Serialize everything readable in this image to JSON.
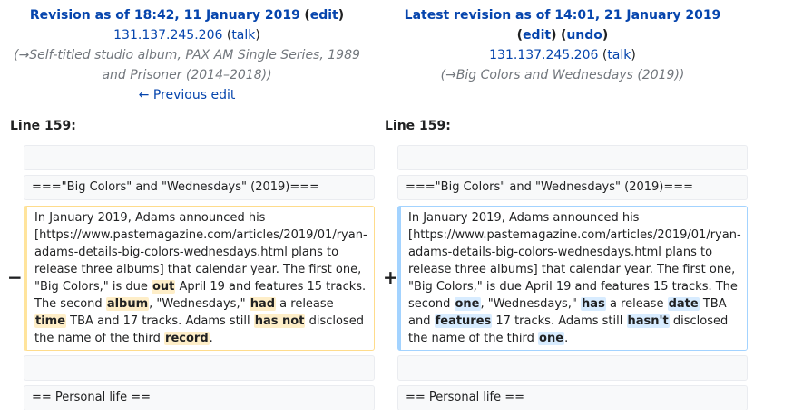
{
  "left_header": {
    "title": "Revision as of 18:42, 11 January 2019",
    "edit": "edit",
    "user": "131.137.245.206",
    "talk": "talk",
    "summary_arrow": "→",
    "summary": "Self-titled studio album, PAX AM Single Series, 1989 and Prisoner (2014–2018)",
    "prev_edit": "← Previous edit"
  },
  "right_header": {
    "title": "Latest revision as of 14:01, 21 January 2019",
    "edit": "edit",
    "undo": "undo",
    "user": "131.137.245.206",
    "talk": "talk",
    "summary_arrow": "→",
    "summary": "Big Colors and Wednesdays (2019)"
  },
  "left_line": "Line 159:",
  "right_line": "Line 159:",
  "context": {
    "heading": "===\"Big Colors\" and \"Wednesdays\" (2019)===",
    "personal": "== Personal life =="
  },
  "markers": {
    "minus": "−",
    "plus": "+"
  },
  "left_para": {
    "t1": "In January 2019, Adams announced his [https://www.pastemagazine.com/articles/2019/01/ryan-adams-details-big-colors-wednesdays.html plans to release three albums] that calendar year. The first one, \"Big Colors,\" is due ",
    "w1": "out",
    "t2": " April 19 and features 15 tracks. The second ",
    "w2": "album",
    "t3": ", \"Wednesdays,\" ",
    "w3": "had",
    "t4": " a release ",
    "w4": "time",
    "t5": " TBA and 17 tracks. Adams still ",
    "w5": "has not",
    "t6": " disclosed the name of the third ",
    "w6": "record",
    "t7": "."
  },
  "right_para": {
    "t1": "In January 2019, Adams announced his [https://www.pastemagazine.com/articles/2019/01/ryan-adams-details-big-colors-wednesdays.html plans to release three albums] that calendar year. The first one, \"Big Colors,\" is due April 19 and features 15 tracks. The second ",
    "w1": "one",
    "t2": ", \"Wednesdays,\" ",
    "w2": "has",
    "t3": " a release ",
    "w3": "date",
    "t4": " TBA and ",
    "w4": "features",
    "t5": " 17 tracks. Adams still ",
    "w5": "hasn't",
    "t6": " disclosed the name of the third ",
    "w6": "one",
    "t7": "."
  }
}
